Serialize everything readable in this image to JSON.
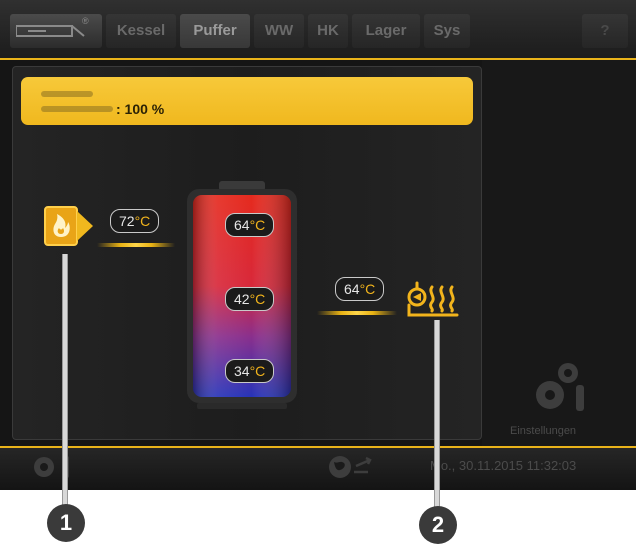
{
  "tabs": [
    {
      "label": "Kessel"
    },
    {
      "label": "Puffer"
    },
    {
      "label": "WW"
    },
    {
      "label": "HK"
    },
    {
      "label": "Lager"
    },
    {
      "label": "Sys"
    }
  ],
  "help_label": "?",
  "logo_registered": "®",
  "status": {
    "value": ": 100 %"
  },
  "temperatures": {
    "source_in": "72",
    "buffer_top": "64",
    "buffer_middle": "42",
    "buffer_bottom": "34",
    "heating_out": "64",
    "unit": "°C"
  },
  "settings_label": "Einstellungen",
  "datetime": "Mo., 30.11.2015 11:32:03",
  "callouts": [
    "1",
    "2"
  ],
  "colors": {
    "accent": "#e9b31a",
    "status_box": "#f0b81e"
  }
}
